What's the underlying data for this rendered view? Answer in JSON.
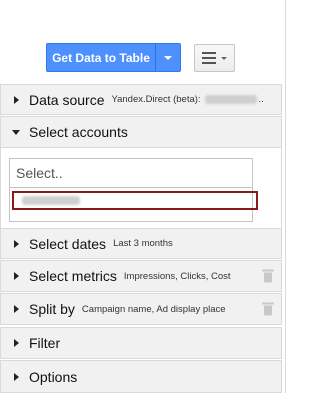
{
  "toolbar": {
    "get_data_label": "Get Data to Table"
  },
  "icons": {
    "menu": "hamburger-menu-icon",
    "dropdown": "chevron-down-icon",
    "delete": "trash-icon"
  },
  "sections": {
    "data_source": {
      "title": "Data source",
      "summary": "Yandex.Direct (beta):",
      "suffix": ".."
    },
    "select_accounts": {
      "title": "Select accounts"
    },
    "select_dates": {
      "title": "Select dates",
      "summary": "Last 3 months"
    },
    "select_metrics": {
      "title": "Select metrics",
      "summary": "Impressions, Clicks, Cost"
    },
    "split_by": {
      "title": "Split by",
      "summary": "Campaign name, Ad display place"
    },
    "filter": {
      "title": "Filter"
    },
    "options": {
      "title": "Options"
    }
  },
  "accounts": {
    "placeholder": "Select.."
  },
  "colors": {
    "primary": "#4d90fe",
    "section_bg": "#f1f1f1",
    "selection_border": "#8b1a1a"
  }
}
